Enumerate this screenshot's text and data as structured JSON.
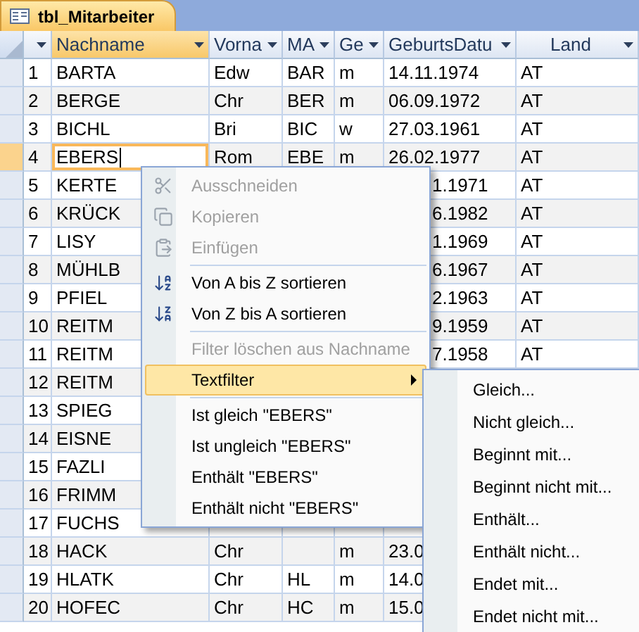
{
  "tab": {
    "title": "tbl_Mitarbeiter"
  },
  "columns": [
    {
      "selected": false
    },
    {
      "label": "Nachname",
      "selected": true
    },
    {
      "label": "Vorna",
      "selected": false
    },
    {
      "label": "MA",
      "selected": false
    },
    {
      "label": "Ge",
      "selected": false
    },
    {
      "label": "GeburtsDatu",
      "selected": false
    },
    {
      "label": "Land",
      "selected": false
    }
  ],
  "rows": [
    {
      "selected": false,
      "cells": [
        "1",
        "BARTA",
        "Edw",
        "BAR",
        "m",
        "14.11.1974",
        "AT"
      ]
    },
    {
      "selected": false,
      "cells": [
        "2",
        "BERGE",
        "Chr",
        "BER",
        "m",
        "06.09.1972",
        "AT"
      ]
    },
    {
      "selected": false,
      "cells": [
        "3",
        "BICHL",
        "Bri",
        "BIC",
        "w",
        "27.03.1961",
        "AT"
      ]
    },
    {
      "selected": true,
      "cells": [
        "4",
        {
          "text": "EBERS",
          "editing": true
        },
        "Rom",
        "EBE",
        "m",
        "26.02.1977",
        "AT"
      ]
    },
    {
      "selected": false,
      "cells": [
        "5",
        "KERTE",
        null,
        null,
        null,
        {
          "text": "1.1971",
          "covered_left": true
        },
        "AT"
      ]
    },
    {
      "selected": false,
      "cells": [
        "6",
        "KRÜCK",
        null,
        null,
        null,
        {
          "text": "6.1982",
          "covered_left": true
        },
        "AT"
      ]
    },
    {
      "selected": false,
      "cells": [
        "7",
        "LISY",
        null,
        null,
        null,
        {
          "text": "1.1969",
          "covered_left": true
        },
        "AT"
      ]
    },
    {
      "selected": false,
      "cells": [
        "8",
        "MÜHLB",
        null,
        null,
        null,
        {
          "text": "6.1967",
          "covered_left": true
        },
        "AT"
      ]
    },
    {
      "selected": false,
      "cells": [
        "9",
        "PFIEL",
        null,
        null,
        null,
        {
          "text": "2.1963",
          "covered_left": true
        },
        "AT"
      ]
    },
    {
      "selected": false,
      "cells": [
        "10",
        "REITM",
        null,
        null,
        null,
        {
          "text": "9.1959",
          "covered_left": true
        },
        "AT"
      ]
    },
    {
      "selected": false,
      "cells": [
        "11",
        "REITM",
        null,
        null,
        null,
        {
          "text": "7.1958",
          "covered_left": true
        },
        "AT"
      ]
    },
    {
      "selected": false,
      "cells": [
        "12",
        "REITM",
        null,
        null,
        null,
        null,
        null
      ]
    },
    {
      "selected": false,
      "cells": [
        "13",
        "SPIEG",
        null,
        null,
        null,
        null,
        null
      ]
    },
    {
      "selected": false,
      "cells": [
        "14",
        "EISNE",
        null,
        null,
        null,
        null,
        null
      ]
    },
    {
      "selected": false,
      "cells": [
        "15",
        "FAZLI",
        null,
        null,
        null,
        null,
        null
      ]
    },
    {
      "selected": false,
      "cells": [
        "16",
        "FRIMM",
        null,
        null,
        null,
        null,
        null
      ]
    },
    {
      "selected": false,
      "cells": [
        "17",
        "FUCHS",
        null,
        null,
        null,
        null,
        null
      ]
    },
    {
      "selected": false,
      "cells": [
        "18",
        "HACK",
        "Chr",
        null,
        "m",
        "23.0",
        null
      ]
    },
    {
      "selected": false,
      "cells": [
        "19",
        "HLATK",
        "Chr",
        "HL",
        "m",
        "14.0",
        null
      ]
    },
    {
      "selected": false,
      "cells": [
        "20",
        "HOFEC",
        "Chr",
        "HC",
        "m",
        "15.0",
        null
      ]
    }
  ],
  "context_menu": {
    "items": [
      {
        "kind": "cut",
        "label": "Ausschneiden",
        "disabled": true
      },
      {
        "kind": "copy",
        "label": "Kopieren",
        "disabled": true
      },
      {
        "kind": "paste",
        "label": "Einfügen",
        "disabled": true
      },
      {
        "kind": "separator"
      },
      {
        "kind": "sort-asc",
        "label": "Von A bis Z sortieren",
        "disabled": false
      },
      {
        "kind": "sort-desc",
        "label": "Von Z bis A sortieren",
        "disabled": false
      },
      {
        "kind": "separator"
      },
      {
        "kind": "item",
        "label": "Filter löschen aus Nachname",
        "disabled": true
      },
      {
        "kind": "submenu",
        "label": "Textfilter",
        "disabled": false,
        "highlighted": true
      },
      {
        "kind": "separator"
      },
      {
        "kind": "item",
        "label": "Ist gleich \"EBERS\"",
        "disabled": false
      },
      {
        "kind": "item",
        "label": "Ist ungleich \"EBERS\"",
        "disabled": false
      },
      {
        "kind": "item",
        "label": "Enthält \"EBERS\"",
        "disabled": false
      },
      {
        "kind": "item",
        "label": "Enthält nicht \"EBERS\"",
        "disabled": false
      }
    ]
  },
  "submenu": {
    "items": [
      "Gleich...",
      "Nicht gleich...",
      "Beginnt mit...",
      "Beginnt nicht mit...",
      "Enthält...",
      "Enthält nicht...",
      "Endet mit...",
      "Endet nicht mit..."
    ]
  }
}
